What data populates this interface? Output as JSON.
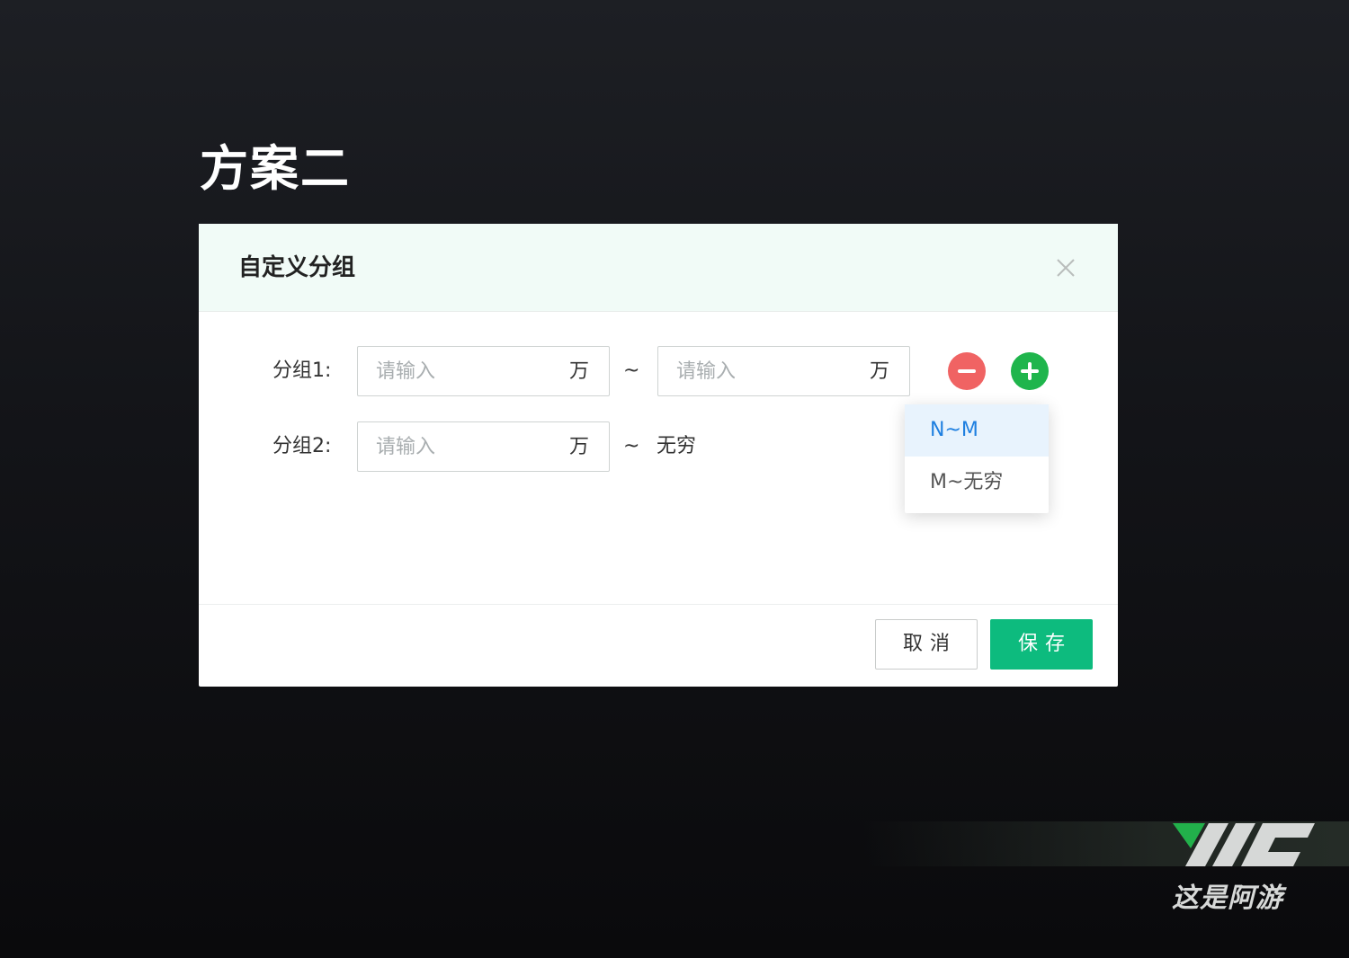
{
  "page": {
    "scheme_title": "方案二"
  },
  "dialog": {
    "title": "自定义分组",
    "rows": [
      {
        "label": "分组1:",
        "from_placeholder": "请输入",
        "from_unit": "万",
        "separator": "~",
        "to_placeholder": "请输入",
        "to_unit": "万"
      },
      {
        "label": "分组2:",
        "from_placeholder": "请输入",
        "from_unit": "万",
        "separator": "~",
        "to_text": "无穷"
      }
    ],
    "dropdown": {
      "items": [
        {
          "label": "N~M",
          "active": true
        },
        {
          "label": "M~无穷",
          "active": false
        }
      ]
    },
    "footer": {
      "cancel_label": "取消",
      "save_label": "保存"
    }
  },
  "watermark": {
    "text": "这是阿游"
  },
  "colors": {
    "header_bg": "#f1fbf7",
    "minus": "#f06363",
    "plus": "#1fb54c",
    "save": "#0dbb7e",
    "dropdown_active_bg": "#e8f3fd",
    "dropdown_active_text": "#1e7fe0"
  },
  "icons": {
    "close": "close-icon",
    "minus": "minus-circle-icon",
    "plus": "plus-circle-icon"
  }
}
